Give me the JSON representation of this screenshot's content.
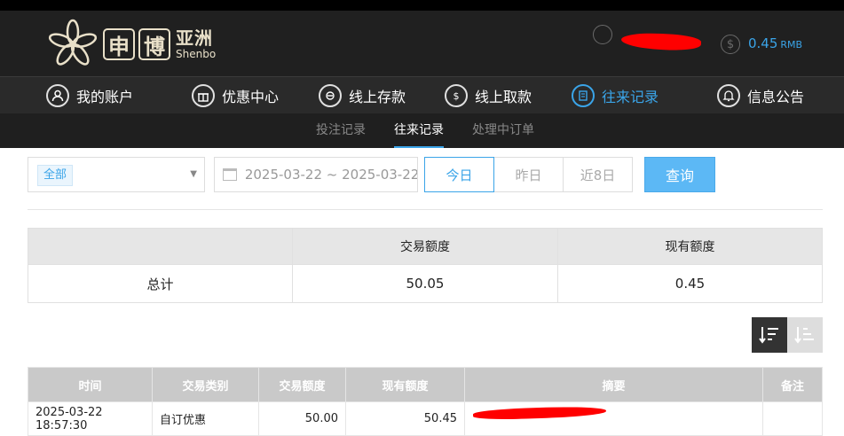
{
  "brand": {
    "cn_box1": "申",
    "cn_box2": "博",
    "cn_text": "亚洲",
    "en_text": "Shenbo"
  },
  "account": {
    "balance": "0.45",
    "unit": "RMB"
  },
  "nav": [
    {
      "label": "我的账户",
      "icon": "user-icon"
    },
    {
      "label": "优惠中心",
      "icon": "gift-icon"
    },
    {
      "label": "线上存款",
      "icon": "deposit-icon"
    },
    {
      "label": "线上取款",
      "icon": "withdraw-icon"
    },
    {
      "label": "往来记录",
      "icon": "records-icon",
      "active": true
    },
    {
      "label": "信息公告",
      "icon": "bell-icon"
    }
  ],
  "subnav": [
    {
      "label": "投注记录"
    },
    {
      "label": "往来记录",
      "active": true
    },
    {
      "label": "处理中订单"
    }
  ],
  "filter": {
    "type_tag": "全部",
    "date_range": "2025-03-22 ~ 2025-03-22",
    "quick_dates": [
      "今日",
      "昨日",
      "近8日"
    ],
    "query_label": "查询"
  },
  "summary": {
    "headers": [
      "",
      "交易额度",
      "现有额度"
    ],
    "row": [
      "总计",
      "50.05",
      "0.45"
    ]
  },
  "records": {
    "headers": [
      "时间",
      "交易类别",
      "交易额度",
      "现有额度",
      "摘要",
      "备注"
    ],
    "rows": [
      [
        "2025-03-22 18:57:30",
        "自订优惠",
        "50.00",
        "50.45",
        "",
        ""
      ]
    ]
  },
  "colors": {
    "accent": "#3aa4e8",
    "header_bg": "#202020",
    "table_head": "#c9c9c9"
  }
}
